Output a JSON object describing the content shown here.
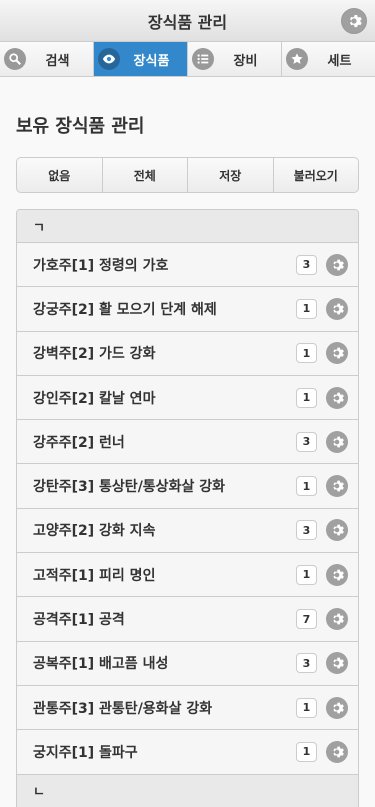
{
  "header": {
    "title": "장식품 관리"
  },
  "tabs": [
    {
      "label": "검색",
      "icon": "search-icon",
      "active": false
    },
    {
      "label": "장식품",
      "icon": "eye-icon",
      "active": true
    },
    {
      "label": "장비",
      "icon": "list-icon",
      "active": false
    },
    {
      "label": "세트",
      "icon": "star-icon",
      "active": false
    }
  ],
  "section": {
    "title": "보유 장식품 관리"
  },
  "buttons": [
    "없음",
    "전체",
    "저장",
    "불러오기"
  ],
  "groups": [
    {
      "header": "ㄱ",
      "items": [
        {
          "label": "가호주[1] 정령의 가호",
          "count": "3"
        },
        {
          "label": "강궁주[2] 활 모으기 단계 해제",
          "count": "1"
        },
        {
          "label": "강벽주[2] 가드 강화",
          "count": "1"
        },
        {
          "label": "강인주[2] 칼날 연마",
          "count": "1"
        },
        {
          "label": "강주주[2] 런너",
          "count": "3"
        },
        {
          "label": "강탄주[3] 통상탄/통상화살 강화",
          "count": "1"
        },
        {
          "label": "고양주[2] 강화 지속",
          "count": "3"
        },
        {
          "label": "고적주[1] 피리 명인",
          "count": "1"
        },
        {
          "label": "공격주[1] 공격",
          "count": "7"
        },
        {
          "label": "공복주[1] 배고픔 내성",
          "count": "3"
        },
        {
          "label": "관통주[3] 관통탄/용화살 강화",
          "count": "1"
        },
        {
          "label": "궁지주[1] 돌파구",
          "count": "1"
        }
      ]
    },
    {
      "header": "ㄴ",
      "items": []
    }
  ],
  "colors": {
    "accent": "#3388cc"
  }
}
